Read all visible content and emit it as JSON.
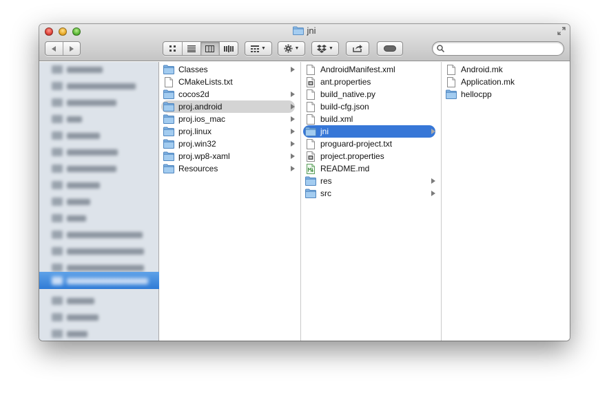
{
  "window": {
    "title": "jni",
    "search": {
      "value": "",
      "placeholder": ""
    }
  },
  "toolbar": {
    "back_icon": "back-arrow-icon",
    "forward_icon": "forward-arrow-icon",
    "view_modes": [
      "icon-view",
      "list-view",
      "column-view",
      "coverflow-view"
    ],
    "active_view": "column-view"
  },
  "colors": {
    "selection_active": "#3777d7",
    "selection_inactive": "#d4d4d4",
    "sidebar_bg": "#dde3ea",
    "sidebar_selected": "#2f7bd6",
    "folder": "#7db3e6"
  },
  "columns": [
    {
      "items": [
        {
          "name": "Classes",
          "kind": "folder",
          "has_children": true
        },
        {
          "name": "CMakeLists.txt",
          "kind": "file",
          "has_children": false
        },
        {
          "name": "cocos2d",
          "kind": "folder",
          "has_children": true
        },
        {
          "name": "proj.android",
          "kind": "folder",
          "has_children": true,
          "selected": "inactive"
        },
        {
          "name": "proj.ios_mac",
          "kind": "folder",
          "has_children": true
        },
        {
          "name": "proj.linux",
          "kind": "folder",
          "has_children": true
        },
        {
          "name": "proj.win32",
          "kind": "folder",
          "has_children": true
        },
        {
          "name": "proj.wp8-xaml",
          "kind": "folder",
          "has_children": true
        },
        {
          "name": "Resources",
          "kind": "folder",
          "has_children": true
        }
      ]
    },
    {
      "items": [
        {
          "name": "AndroidManifest.xml",
          "kind": "file",
          "has_children": false
        },
        {
          "name": "ant.properties",
          "kind": "props",
          "has_children": false
        },
        {
          "name": "build_native.py",
          "kind": "file",
          "has_children": false
        },
        {
          "name": "build-cfg.json",
          "kind": "file",
          "has_children": false
        },
        {
          "name": "build.xml",
          "kind": "file",
          "has_children": false
        },
        {
          "name": "jni",
          "kind": "folder",
          "has_children": true,
          "selected": "active"
        },
        {
          "name": "proguard-project.txt",
          "kind": "file",
          "has_children": false
        },
        {
          "name": "project.properties",
          "kind": "props",
          "has_children": false
        },
        {
          "name": "README.md",
          "kind": "markdown",
          "has_children": false
        },
        {
          "name": "res",
          "kind": "folder",
          "has_children": true
        },
        {
          "name": "src",
          "kind": "folder",
          "has_children": true
        }
      ]
    },
    {
      "items": [
        {
          "name": "Android.mk",
          "kind": "file",
          "has_children": false
        },
        {
          "name": "Application.mk",
          "kind": "file",
          "has_children": false
        },
        {
          "name": "hellocpp",
          "kind": "folder",
          "has_children": false
        }
      ]
    }
  ]
}
